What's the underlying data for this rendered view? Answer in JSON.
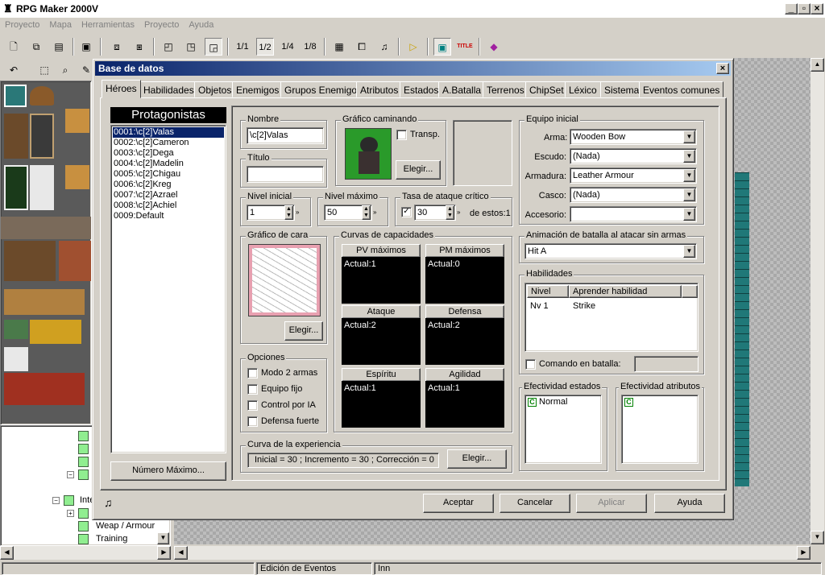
{
  "app": {
    "title": "RPG Maker 2000V",
    "window_controls": [
      "_",
      "▫",
      "×"
    ]
  },
  "menu": {
    "items": [
      "Proyecto",
      "Mapa",
      "Herramientas",
      "Proyecto",
      "Ayuda"
    ]
  },
  "toolbar": {
    "layer_labels": [
      "1/1",
      "1/2",
      "1/4",
      "1/8"
    ],
    "title_icon_text": "TITLE"
  },
  "tree": {
    "items": [
      "Inte",
      "Weap / Armour",
      "Training"
    ]
  },
  "status": {
    "mode": "Edición de Eventos",
    "map": "Inn"
  },
  "dialog": {
    "title": "Base de datos",
    "close": "×",
    "tabs": [
      "Héroes",
      "Habilidades",
      "Objetos",
      "Enemigos",
      "Grupos Enemigos",
      "Atributos",
      "Estados",
      "A.Batalla",
      "Terrenos",
      "ChipSet",
      "Léxico",
      "Sistema",
      "Eventos comunes"
    ],
    "active_tab": "Héroes",
    "list_title": "Protagonistas",
    "heroes": [
      "0001:\\c[2]Valas",
      "0002:\\c[2]Cameron",
      "0003:\\c[2]Dega",
      "0004:\\c[2]Madelin",
      "0005:\\c[2]Chigau",
      "0006:\\c[2]Kreg",
      "0007:\\c[2]Azrael",
      "0008:\\c[2]Achiel",
      "0009:Default"
    ],
    "selected_hero": "0001:\\c[2]Valas",
    "max_button": "Número Máximo...",
    "name": {
      "label": "Nombre",
      "value": "\\c[2]Valas"
    },
    "title_field": {
      "label": "Título",
      "value": ""
    },
    "walk_graphic": {
      "label": "Gráfico caminando",
      "transp_label": "Transp.",
      "choose": "Elegir..."
    },
    "level_initial": {
      "label": "Nivel inicial",
      "value": "1"
    },
    "level_max": {
      "label": "Nivel máximo",
      "value": "50"
    },
    "crit": {
      "label": "Tasa de ataque crítico",
      "value": "30",
      "suffix": "de estos:1"
    },
    "face": {
      "label": "Gráfico de cara",
      "choose": "Elegir..."
    },
    "curves": {
      "label": "Curvas de capacidades",
      "items": [
        {
          "name": "PV máximos",
          "value": "Actual:1"
        },
        {
          "name": "PM máximos",
          "value": "Actual:0"
        },
        {
          "name": "Ataque",
          "value": "Actual:2"
        },
        {
          "name": "Defensa",
          "value": "Actual:2"
        },
        {
          "name": "Espíritu",
          "value": "Actual:1"
        },
        {
          "name": "Agilidad",
          "value": "Actual:1"
        }
      ]
    },
    "options": {
      "label": "Opciones",
      "items": [
        "Modo 2 armas",
        "Equipo fijo",
        "Control por IA",
        "Defensa fuerte"
      ]
    },
    "exp": {
      "label": "Curva de la experiencia",
      "value": "Inicial = 30 ; Incremento = 30 ; Corrección = 0",
      "choose": "Elegir..."
    },
    "equip": {
      "label": "Equipo inicial",
      "rows": [
        {
          "name": "Arma:",
          "value": "Wooden Bow"
        },
        {
          "name": "Escudo:",
          "value": "(Nada)"
        },
        {
          "name": "Armadura:",
          "value": "Leather Armour"
        },
        {
          "name": "Casco:",
          "value": "(Nada)"
        },
        {
          "name": "Accesorio:",
          "value": ""
        }
      ]
    },
    "unarmed": {
      "label": "Animación de batalla al atacar sin armas",
      "value": "Hit A"
    },
    "skills": {
      "label": "Habilidades",
      "col_level": "Nivel",
      "col_skill": "Aprender habilidad",
      "rows": [
        {
          "level": "Nv 1",
          "skill": "Strike"
        }
      ],
      "battle_cmd": "Comando en batalla:"
    },
    "state_eff": {
      "label": "Efectividad estados",
      "items": [
        "Normal"
      ],
      "badge": "C"
    },
    "attr_eff": {
      "label": "Efectividad atributos",
      "badge": "C"
    },
    "buttons": {
      "ok": "Aceptar",
      "cancel": "Cancelar",
      "apply": "Aplicar",
      "help": "Ayuda"
    }
  }
}
